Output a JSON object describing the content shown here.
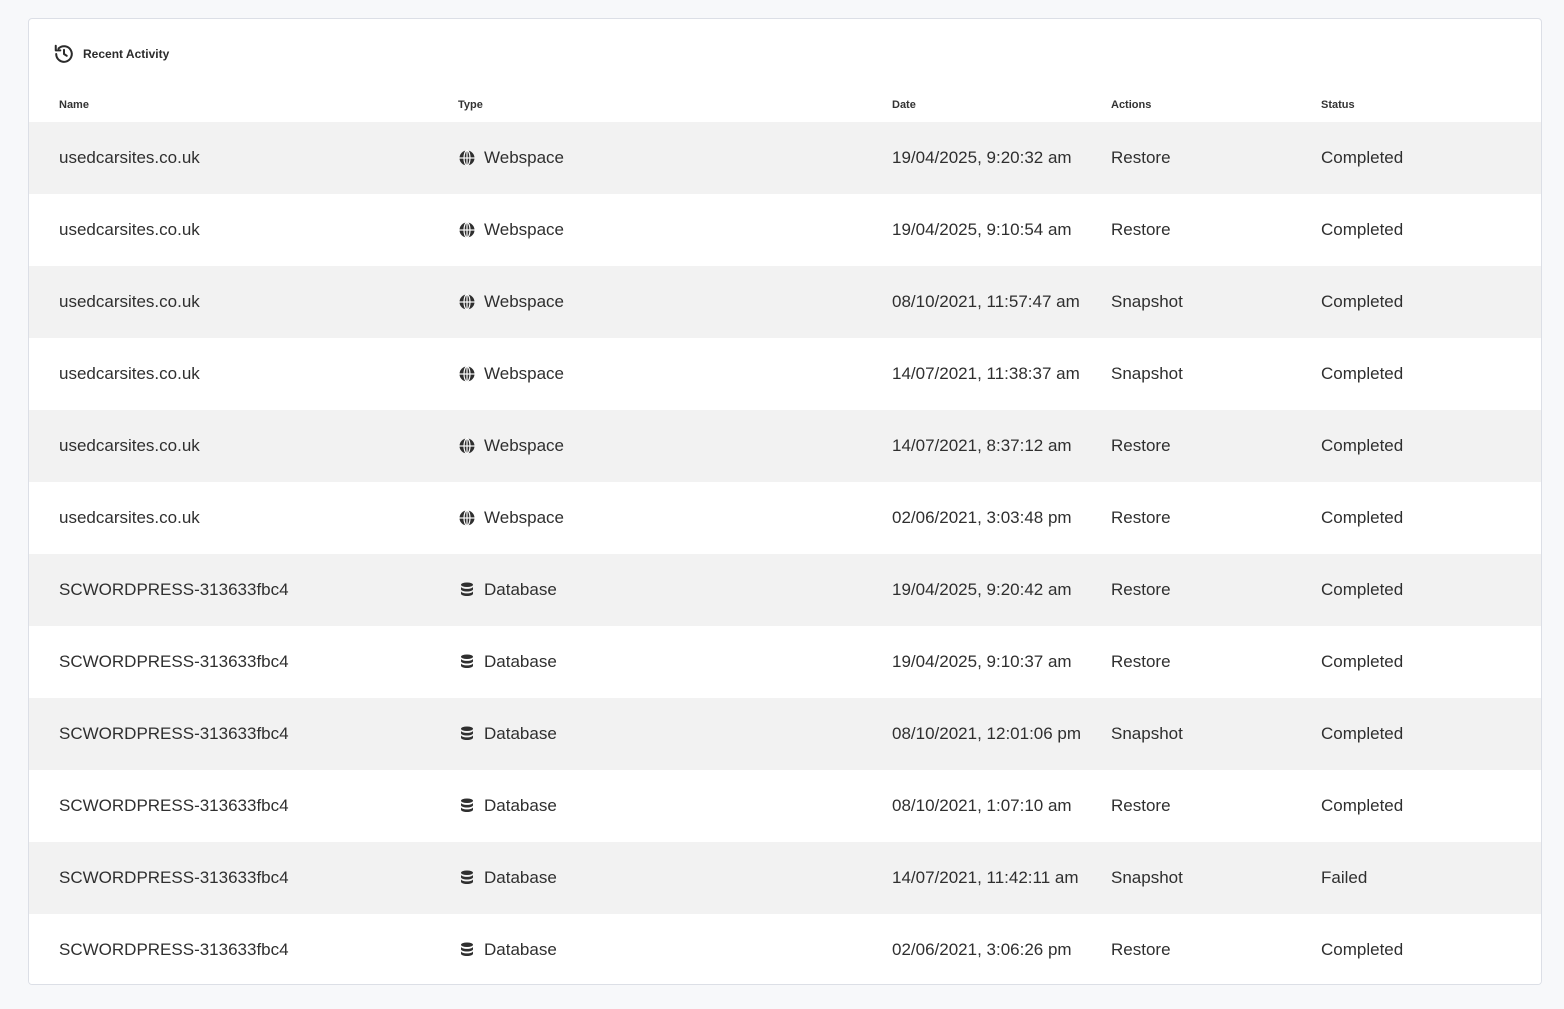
{
  "panel": {
    "title": "Recent Activity",
    "icon": "history-icon"
  },
  "table": {
    "columns": {
      "name": "Name",
      "type": "Type",
      "date": "Date",
      "actions": "Actions",
      "status": "Status"
    },
    "rows": [
      {
        "name": "usedcarsites.co.uk",
        "type": "Webspace",
        "type_icon": "globe-icon",
        "date": "19/04/2025, 9:20:32 am",
        "action": "Restore",
        "status": "Completed"
      },
      {
        "name": "usedcarsites.co.uk",
        "type": "Webspace",
        "type_icon": "globe-icon",
        "date": "19/04/2025, 9:10:54 am",
        "action": "Restore",
        "status": "Completed"
      },
      {
        "name": "usedcarsites.co.uk",
        "type": "Webspace",
        "type_icon": "globe-icon",
        "date": "08/10/2021, 11:57:47 am",
        "action": "Snapshot",
        "status": "Completed"
      },
      {
        "name": "usedcarsites.co.uk",
        "type": "Webspace",
        "type_icon": "globe-icon",
        "date": "14/07/2021, 11:38:37 am",
        "action": "Snapshot",
        "status": "Completed"
      },
      {
        "name": "usedcarsites.co.uk",
        "type": "Webspace",
        "type_icon": "globe-icon",
        "date": "14/07/2021, 8:37:12 am",
        "action": "Restore",
        "status": "Completed"
      },
      {
        "name": "usedcarsites.co.uk",
        "type": "Webspace",
        "type_icon": "globe-icon",
        "date": "02/06/2021, 3:03:48 pm",
        "action": "Restore",
        "status": "Completed"
      },
      {
        "name": "SCWORDPRESS-313633fbc4",
        "type": "Database",
        "type_icon": "database-icon",
        "date": "19/04/2025, 9:20:42 am",
        "action": "Restore",
        "status": "Completed"
      },
      {
        "name": "SCWORDPRESS-313633fbc4",
        "type": "Database",
        "type_icon": "database-icon",
        "date": "19/04/2025, 9:10:37 am",
        "action": "Restore",
        "status": "Completed"
      },
      {
        "name": "SCWORDPRESS-313633fbc4",
        "type": "Database",
        "type_icon": "database-icon",
        "date": "08/10/2021, 12:01:06 pm",
        "action": "Snapshot",
        "status": "Completed"
      },
      {
        "name": "SCWORDPRESS-313633fbc4",
        "type": "Database",
        "type_icon": "database-icon",
        "date": "08/10/2021, 1:07:10 am",
        "action": "Restore",
        "status": "Completed"
      },
      {
        "name": "SCWORDPRESS-313633fbc4",
        "type": "Database",
        "type_icon": "database-icon",
        "date": "14/07/2021, 11:42:11 am",
        "action": "Snapshot",
        "status": "Failed"
      },
      {
        "name": "SCWORDPRESS-313633fbc4",
        "type": "Database",
        "type_icon": "database-icon",
        "date": "02/06/2021, 3:06:26 pm",
        "action": "Restore",
        "status": "Completed"
      }
    ]
  }
}
